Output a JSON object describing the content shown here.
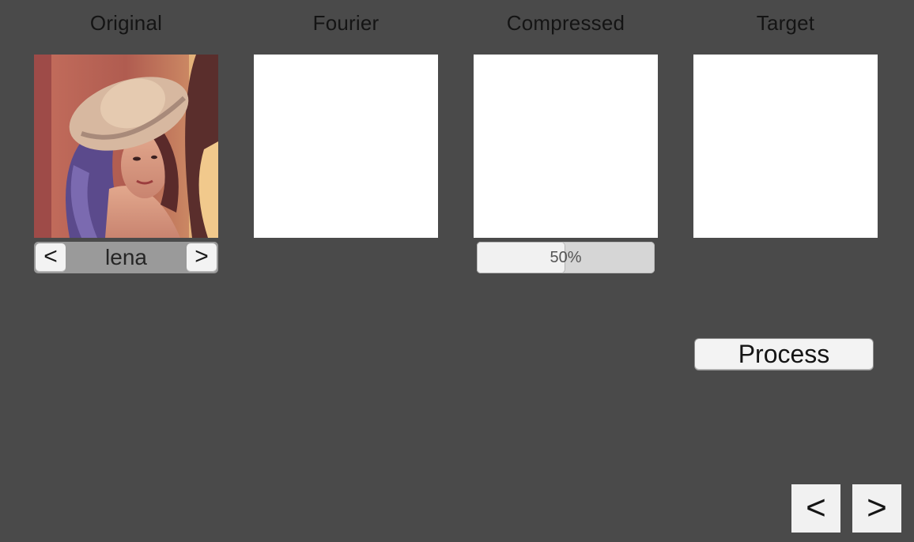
{
  "columns": {
    "original": "Original",
    "fourier": "Fourier",
    "compressed": "Compressed",
    "target": "Target"
  },
  "image_selector": {
    "prev_label": "<",
    "name": "lena",
    "next_label": ">"
  },
  "compression_slider": {
    "label": "50%",
    "value": 0.5
  },
  "process_button": {
    "label": "Process"
  },
  "navigation": {
    "prev_label": "<",
    "next_label": ">"
  },
  "colors": {
    "background": "#4a4a4a",
    "panel": "#ffffff",
    "button": "#f3f3f3"
  }
}
